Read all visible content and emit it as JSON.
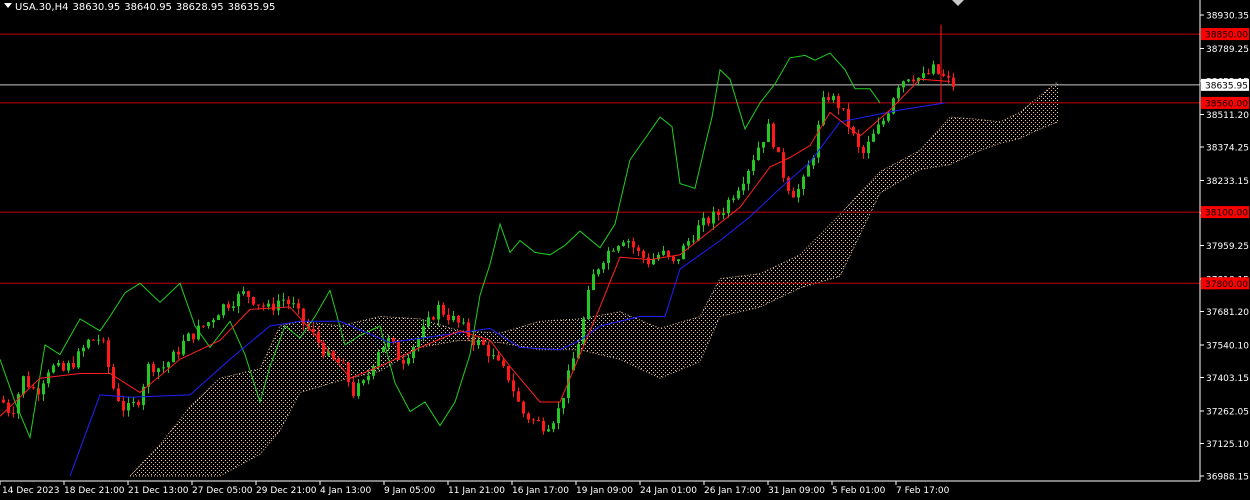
{
  "header": {
    "symbol": "USA.30,H4",
    "open": "38630.95",
    "high": "38640.95",
    "low": "38628.95",
    "close": "38635.95"
  },
  "colors": {
    "background": "#000000",
    "bull_candle": "#26c626",
    "bear_candle": "#ff1a1a",
    "tenkan": "#ff2020",
    "kijun": "#2020ff",
    "chikou": "#20d020",
    "cloud": "#f0c8a0",
    "level_line": "#c00000",
    "price_line": "#c8c8c8",
    "axis": "#ffffff"
  },
  "chart_data": {
    "type": "candlestick",
    "y_axis": {
      "min": 36988.15,
      "max": 38930.35,
      "ticks": [
        "38930.35",
        "38789.25",
        "38652.15",
        "38511.20",
        "38374.25",
        "38233.15",
        "38096.20",
        "37959.25",
        "37818.15",
        "37681.20",
        "37540.10",
        "37403.15",
        "37262.05",
        "37125.10",
        "36988.15"
      ]
    },
    "x_axis": {
      "labels": [
        "14 Dec 2023",
        "18 Dec 21:00",
        "21 Dec 13:00",
        "27 Dec 05:00",
        "29 Dec 21:00",
        "4 Jan 13:00",
        "9 Jan 05:00",
        "11 Jan 21:00",
        "16 Jan 17:00",
        "19 Jan 09:00",
        "24 Jan 01:00",
        "26 Jan 17:00",
        "31 Jan 09:00",
        "5 Feb 01:00",
        "7 Feb 17:00"
      ]
    },
    "levels": [
      {
        "value": 38850.0,
        "label": "38850.00"
      },
      {
        "value": 38560.0,
        "label": "38560.00"
      },
      {
        "value": 38100.0,
        "label": "38100.00"
      },
      {
        "value": 37800.0,
        "label": "37800.00"
      }
    ],
    "current_price": {
      "value": 38635.95,
      "label": "38635.95"
    },
    "close_path": [
      [
        0,
        37310
      ],
      [
        10,
        37250
      ],
      [
        22,
        37400
      ],
      [
        35,
        37340
      ],
      [
        48,
        37450
      ],
      [
        62,
        37430
      ],
      [
        75,
        37480
      ],
      [
        88,
        37560
      ],
      [
        100,
        37570
      ],
      [
        112,
        37360
      ],
      [
        124,
        37260
      ],
      [
        136,
        37300
      ],
      [
        148,
        37460
      ],
      [
        160,
        37440
      ],
      [
        172,
        37490
      ],
      [
        184,
        37560
      ],
      [
        196,
        37600
      ],
      [
        208,
        37640
      ],
      [
        220,
        37700
      ],
      [
        232,
        37730
      ],
      [
        244,
        37760
      ],
      [
        256,
        37720
      ],
      [
        268,
        37690
      ],
      [
        280,
        37740
      ],
      [
        292,
        37700
      ],
      [
        304,
        37620
      ],
      [
        316,
        37560
      ],
      [
        328,
        37480
      ],
      [
        340,
        37460
      ],
      [
        352,
        37340
      ],
      [
        364,
        37380
      ],
      [
        376,
        37520
      ],
      [
        388,
        37560
      ],
      [
        400,
        37470
      ],
      [
        412,
        37540
      ],
      [
        424,
        37610
      ],
      [
        436,
        37700
      ],
      [
        448,
        37660
      ],
      [
        460,
        37620
      ],
      [
        472,
        37560
      ],
      [
        484,
        37530
      ],
      [
        496,
        37460
      ],
      [
        508,
        37400
      ],
      [
        520,
        37260
      ],
      [
        532,
        37220
      ],
      [
        544,
        37200
      ],
      [
        556,
        37250
      ],
      [
        568,
        37420
      ],
      [
        580,
        37600
      ],
      [
        590,
        37810
      ],
      [
        600,
        37900
      ],
      [
        612,
        37960
      ],
      [
        624,
        38000
      ],
      [
        636,
        37930
      ],
      [
        648,
        37890
      ],
      [
        660,
        37930
      ],
      [
        672,
        37880
      ],
      [
        684,
        37960
      ],
      [
        696,
        38030
      ],
      [
        708,
        38070
      ],
      [
        720,
        38100
      ],
      [
        732,
        38180
      ],
      [
        744,
        38260
      ],
      [
        756,
        38370
      ],
      [
        768,
        38460
      ],
      [
        780,
        38280
      ],
      [
        790,
        38180
      ],
      [
        800,
        38200
      ],
      [
        812,
        38350
      ],
      [
        824,
        38600
      ],
      [
        836,
        38560
      ],
      [
        848,
        38460
      ],
      [
        860,
        38330
      ],
      [
        872,
        38420
      ],
      [
        884,
        38500
      ],
      [
        896,
        38640
      ],
      [
        908,
        38680
      ],
      [
        920,
        38660
      ],
      [
        932,
        38700
      ],
      [
        944,
        38660
      ],
      [
        952,
        38636
      ]
    ],
    "tenkan_path": [
      [
        0,
        37240
      ],
      [
        40,
        37400
      ],
      [
        80,
        37420
      ],
      [
        110,
        37420
      ],
      [
        140,
        37340
      ],
      [
        180,
        37480
      ],
      [
        220,
        37560
      ],
      [
        250,
        37690
      ],
      [
        290,
        37700
      ],
      [
        320,
        37560
      ],
      [
        350,
        37400
      ],
      [
        380,
        37450
      ],
      [
        420,
        37530
      ],
      [
        460,
        37600
      ],
      [
        490,
        37560
      ],
      [
        510,
        37450
      ],
      [
        540,
        37300
      ],
      [
        560,
        37300
      ],
      [
        580,
        37500
      ],
      [
        600,
        37700
      ],
      [
        620,
        37910
      ],
      [
        650,
        37900
      ],
      [
        680,
        37920
      ],
      [
        710,
        38020
      ],
      [
        740,
        38120
      ],
      [
        770,
        38290
      ],
      [
        790,
        38330
      ],
      [
        810,
        38380
      ],
      [
        830,
        38520
      ],
      [
        860,
        38420
      ],
      [
        890,
        38530
      ],
      [
        920,
        38660
      ],
      [
        950,
        38650
      ]
    ],
    "kijun_path": [
      [
        70,
        36988
      ],
      [
        100,
        37330
      ],
      [
        130,
        37320
      ],
      [
        190,
        37330
      ],
      [
        230,
        37480
      ],
      [
        270,
        37620
      ],
      [
        300,
        37640
      ],
      [
        340,
        37640
      ],
      [
        390,
        37550
      ],
      [
        440,
        37580
      ],
      [
        490,
        37610
      ],
      [
        520,
        37530
      ],
      [
        560,
        37520
      ],
      [
        580,
        37560
      ],
      [
        600,
        37620
      ],
      [
        640,
        37660
      ],
      [
        665,
        37660
      ],
      [
        680,
        37860
      ],
      [
        720,
        37980
      ],
      [
        750,
        38080
      ],
      [
        780,
        38200
      ],
      [
        810,
        38310
      ],
      [
        840,
        38480
      ],
      [
        900,
        38530
      ],
      [
        945,
        38560
      ]
    ],
    "chikou_path": [
      [
        0,
        37480
      ],
      [
        15,
        37300
      ],
      [
        30,
        37150
      ],
      [
        45,
        37540
      ],
      [
        60,
        37500
      ],
      [
        80,
        37650
      ],
      [
        100,
        37600
      ],
      [
        110,
        37660
      ],
      [
        125,
        37760
      ],
      [
        140,
        37800
      ],
      [
        160,
        37720
      ],
      [
        180,
        37800
      ],
      [
        195,
        37620
      ],
      [
        210,
        37530
      ],
      [
        230,
        37640
      ],
      [
        245,
        37500
      ],
      [
        260,
        37300
      ],
      [
        270,
        37450
      ],
      [
        285,
        37620
      ],
      [
        300,
        37570
      ],
      [
        315,
        37660
      ],
      [
        330,
        37770
      ],
      [
        345,
        37540
      ],
      [
        360,
        37580
      ],
      [
        380,
        37620
      ],
      [
        395,
        37380
      ],
      [
        410,
        37260
      ],
      [
        425,
        37300
      ],
      [
        440,
        37200
      ],
      [
        455,
        37300
      ],
      [
        470,
        37500
      ],
      [
        480,
        37750
      ],
      [
        490,
        37880
      ],
      [
        500,
        38050
      ],
      [
        510,
        37930
      ],
      [
        520,
        37980
      ],
      [
        535,
        37930
      ],
      [
        550,
        37920
      ],
      [
        565,
        37960
      ],
      [
        580,
        38020
      ],
      [
        600,
        37950
      ],
      [
        615,
        38050
      ],
      [
        630,
        38320
      ],
      [
        645,
        38410
      ],
      [
        660,
        38500
      ],
      [
        672,
        38460
      ],
      [
        680,
        38220
      ],
      [
        695,
        38200
      ],
      [
        705,
        38380
      ],
      [
        712,
        38500
      ],
      [
        720,
        38700
      ],
      [
        730,
        38660
      ],
      [
        745,
        38450
      ],
      [
        760,
        38560
      ],
      [
        775,
        38640
      ],
      [
        790,
        38750
      ],
      [
        805,
        38760
      ],
      [
        815,
        38740
      ],
      [
        830,
        38770
      ],
      [
        845,
        38700
      ],
      [
        855,
        38620
      ],
      [
        870,
        38620
      ],
      [
        880,
        38560
      ]
    ],
    "cloud_top_path": [
      [
        130,
        36988
      ],
      [
        160,
        37120
      ],
      [
        190,
        37280
      ],
      [
        220,
        37400
      ],
      [
        260,
        37440
      ],
      [
        280,
        37620
      ],
      [
        300,
        37640
      ],
      [
        340,
        37620
      ],
      [
        380,
        37660
      ],
      [
        420,
        37650
      ],
      [
        460,
        37600
      ],
      [
        500,
        37590
      ],
      [
        540,
        37640
      ],
      [
        580,
        37650
      ],
      [
        620,
        37680
      ],
      [
        660,
        37610
      ],
      [
        700,
        37660
      ],
      [
        720,
        37820
      ],
      [
        760,
        37840
      ],
      [
        800,
        37920
      ],
      [
        840,
        38090
      ],
      [
        880,
        38270
      ],
      [
        920,
        38360
      ],
      [
        950,
        38500
      ],
      [
        980,
        38490
      ],
      [
        1000,
        38480
      ],
      [
        1020,
        38520
      ],
      [
        1040,
        38590
      ],
      [
        1058,
        38650
      ]
    ],
    "cloud_bottom_path": [
      [
        130,
        36988
      ],
      [
        160,
        36988
      ],
      [
        190,
        36988
      ],
      [
        220,
        36988
      ],
      [
        260,
        37080
      ],
      [
        280,
        37180
      ],
      [
        300,
        37340
      ],
      [
        340,
        37390
      ],
      [
        380,
        37430
      ],
      [
        420,
        37530
      ],
      [
        460,
        37560
      ],
      [
        500,
        37550
      ],
      [
        540,
        37520
      ],
      [
        580,
        37520
      ],
      [
        620,
        37480
      ],
      [
        660,
        37400
      ],
      [
        700,
        37470
      ],
      [
        720,
        37660
      ],
      [
        760,
        37700
      ],
      [
        800,
        37780
      ],
      [
        840,
        37830
      ],
      [
        880,
        38180
      ],
      [
        920,
        38280
      ],
      [
        950,
        38300
      ],
      [
        980,
        38360
      ],
      [
        1000,
        38390
      ],
      [
        1020,
        38410
      ],
      [
        1040,
        38450
      ],
      [
        1058,
        38480
      ]
    ]
  }
}
